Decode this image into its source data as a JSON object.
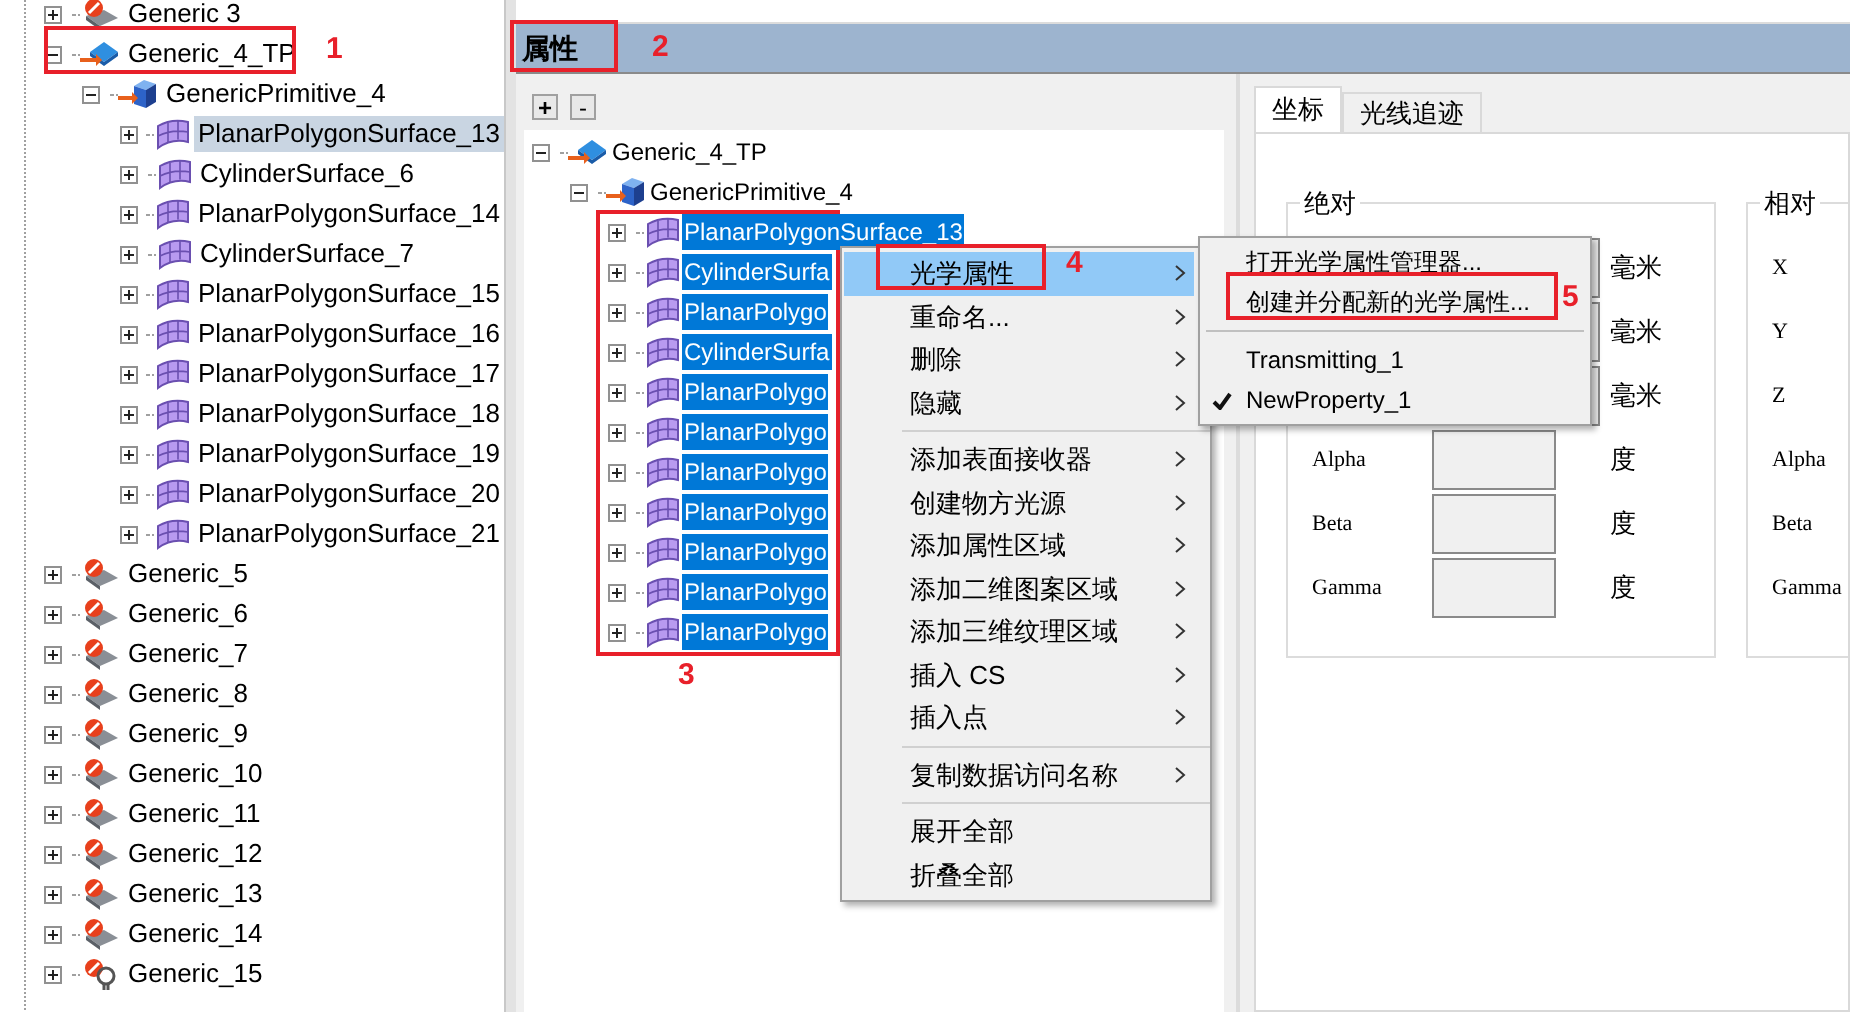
{
  "object_tree": {
    "nodes": [
      {
        "label": "Generic 3",
        "kind": "generic",
        "expanded": false,
        "selected": false
      },
      {
        "label": "Generic_4_TP",
        "kind": "tp",
        "expanded": true,
        "selected": false,
        "children": [
          {
            "label": "GenericPrimitive_4",
            "kind": "primitive",
            "expanded": true,
            "selected": false,
            "children": [
              {
                "label": "PlanarPolygonSurface_13",
                "kind": "surface",
                "expanded": false,
                "selected": true
              },
              {
                "label": "CylinderSurface_6",
                "kind": "surface",
                "expanded": false,
                "selected": false
              },
              {
                "label": "PlanarPolygonSurface_14",
                "kind": "surface",
                "expanded": false,
                "selected": false
              },
              {
                "label": "CylinderSurface_7",
                "kind": "surface",
                "expanded": false,
                "selected": false
              },
              {
                "label": "PlanarPolygonSurface_15",
                "kind": "surface",
                "expanded": false,
                "selected": false
              },
              {
                "label": "PlanarPolygonSurface_16",
                "kind": "surface",
                "expanded": false,
                "selected": false
              },
              {
                "label": "PlanarPolygonSurface_17",
                "kind": "surface",
                "expanded": false,
                "selected": false
              },
              {
                "label": "PlanarPolygonSurface_18",
                "kind": "surface",
                "expanded": false,
                "selected": false
              },
              {
                "label": "PlanarPolygonSurface_19",
                "kind": "surface",
                "expanded": false,
                "selected": false
              },
              {
                "label": "PlanarPolygonSurface_20",
                "kind": "surface",
                "expanded": false,
                "selected": false
              },
              {
                "label": "PlanarPolygonSurface_21",
                "kind": "surface",
                "expanded": false,
                "selected": false
              }
            ]
          }
        ]
      },
      {
        "label": "Generic_5",
        "kind": "generic",
        "expanded": false,
        "selected": false
      },
      {
        "label": "Generic_6",
        "kind": "generic",
        "expanded": false,
        "selected": false
      },
      {
        "label": "Generic_7",
        "kind": "generic",
        "expanded": false,
        "selected": false
      },
      {
        "label": "Generic_8",
        "kind": "generic",
        "expanded": false,
        "selected": false
      },
      {
        "label": "Generic_9",
        "kind": "generic",
        "expanded": false,
        "selected": false
      },
      {
        "label": "Generic_10",
        "kind": "generic",
        "expanded": false,
        "selected": false
      },
      {
        "label": "Generic_11",
        "kind": "generic",
        "expanded": false,
        "selected": false
      },
      {
        "label": "Generic_12",
        "kind": "generic",
        "expanded": false,
        "selected": false
      },
      {
        "label": "Generic_13",
        "kind": "generic",
        "expanded": false,
        "selected": false
      },
      {
        "label": "Generic_14",
        "kind": "generic",
        "expanded": false,
        "selected": false
      },
      {
        "label": "Generic_15",
        "kind": "light",
        "expanded": false,
        "selected": false
      }
    ]
  },
  "properties_panel": {
    "title": "属性",
    "expand_all_button": "+",
    "collapse_all_button": "-",
    "tree": {
      "nodes": [
        {
          "label": "Generic_4_TP",
          "kind": "tp",
          "expanded": true,
          "selected": false,
          "children": [
            {
              "label": "GenericPrimitive_4",
              "kind": "primitive",
              "expanded": true,
              "selected": false,
              "children": [
                {
                  "label": "PlanarPolygonSurface_13",
                  "kind": "surface",
                  "expanded": false,
                  "selected": true
                },
                {
                  "label": "CylinderSurfa",
                  "kind": "surface",
                  "expanded": false,
                  "selected": true
                },
                {
                  "label": "PlanarPolygo",
                  "kind": "surface",
                  "expanded": false,
                  "selected": true
                },
                {
                  "label": "CylinderSurfa",
                  "kind": "surface",
                  "expanded": false,
                  "selected": true
                },
                {
                  "label": "PlanarPolygo",
                  "kind": "surface",
                  "expanded": false,
                  "selected": true
                },
                {
                  "label": "PlanarPolygo",
                  "kind": "surface",
                  "expanded": false,
                  "selected": true
                },
                {
                  "label": "PlanarPolygo",
                  "kind": "surface",
                  "expanded": false,
                  "selected": true
                },
                {
                  "label": "PlanarPolygo",
                  "kind": "surface",
                  "expanded": false,
                  "selected": true
                },
                {
                  "label": "PlanarPolygo",
                  "kind": "surface",
                  "expanded": false,
                  "selected": true
                },
                {
                  "label": "PlanarPolygo",
                  "kind": "surface",
                  "expanded": false,
                  "selected": true
                },
                {
                  "label": "PlanarPolygo",
                  "kind": "surface",
                  "expanded": false,
                  "selected": true
                }
              ]
            }
          ]
        }
      ]
    },
    "tabs": [
      {
        "label": "坐标",
        "selected": true
      },
      {
        "label": "光线追迹",
        "selected": false
      }
    ],
    "absolute_group": {
      "title": "绝对",
      "rows": [
        {
          "kind": "length",
          "unit": "毫米"
        },
        {
          "kind": "length",
          "unit": "毫米"
        },
        {
          "kind": "length",
          "unit": "毫米"
        },
        {
          "kind": "angle",
          "label": "Alpha",
          "unit": "度"
        },
        {
          "kind": "angle",
          "label": "Beta",
          "unit": "度"
        },
        {
          "kind": "angle",
          "label": "Gamma",
          "unit": "度"
        }
      ]
    },
    "relative_group": {
      "title": "相对",
      "rows": [
        {
          "label": "X"
        },
        {
          "label": "Y"
        },
        {
          "label": "Z"
        },
        {
          "label": "Alpha"
        },
        {
          "label": "Beta"
        },
        {
          "label": "Gamma"
        }
      ]
    }
  },
  "context_menu": {
    "items": [
      {
        "label": "光学属性",
        "kind": "submenu",
        "selected": true
      },
      {
        "label": "重命名...",
        "kind": "submenu",
        "selected": false
      },
      {
        "label": "删除",
        "kind": "submenu",
        "selected": false
      },
      {
        "label": "隐藏",
        "kind": "submenu",
        "selected": false
      },
      {
        "kind": "separator"
      },
      {
        "label": "添加表面接收器",
        "kind": "submenu",
        "selected": false
      },
      {
        "label": "创建物方光源",
        "kind": "submenu",
        "selected": false
      },
      {
        "label": "添加属性区域",
        "kind": "submenu",
        "selected": false
      },
      {
        "label": "添加二维图案区域",
        "kind": "submenu",
        "selected": false
      },
      {
        "label": "添加三维纹理区域",
        "kind": "submenu",
        "selected": false
      },
      {
        "label": "插入 CS",
        "kind": "submenu",
        "selected": false
      },
      {
        "label": "插入点",
        "kind": "submenu",
        "selected": false
      },
      {
        "kind": "separator"
      },
      {
        "label": "复制数据访问名称",
        "kind": "submenu",
        "selected": false
      },
      {
        "kind": "separator"
      },
      {
        "label": "展开全部",
        "kind": "action",
        "selected": false
      },
      {
        "label": "折叠全部",
        "kind": "action",
        "selected": false
      }
    ]
  },
  "submenu": {
    "items": [
      {
        "label": "打开光学属性管理器...",
        "kind": "action",
        "checked": false
      },
      {
        "label": "创建并分配新的光学属性...",
        "kind": "action",
        "checked": false
      },
      {
        "kind": "separator"
      },
      {
        "label": "Transmitting_1",
        "kind": "action",
        "checked": false
      },
      {
        "label": "NewProperty_1",
        "kind": "action",
        "checked": true
      }
    ]
  },
  "annotations": [
    {
      "label": "1"
    },
    {
      "label": "2"
    },
    {
      "label": "3"
    },
    {
      "label": "4"
    },
    {
      "label": "5"
    }
  ]
}
